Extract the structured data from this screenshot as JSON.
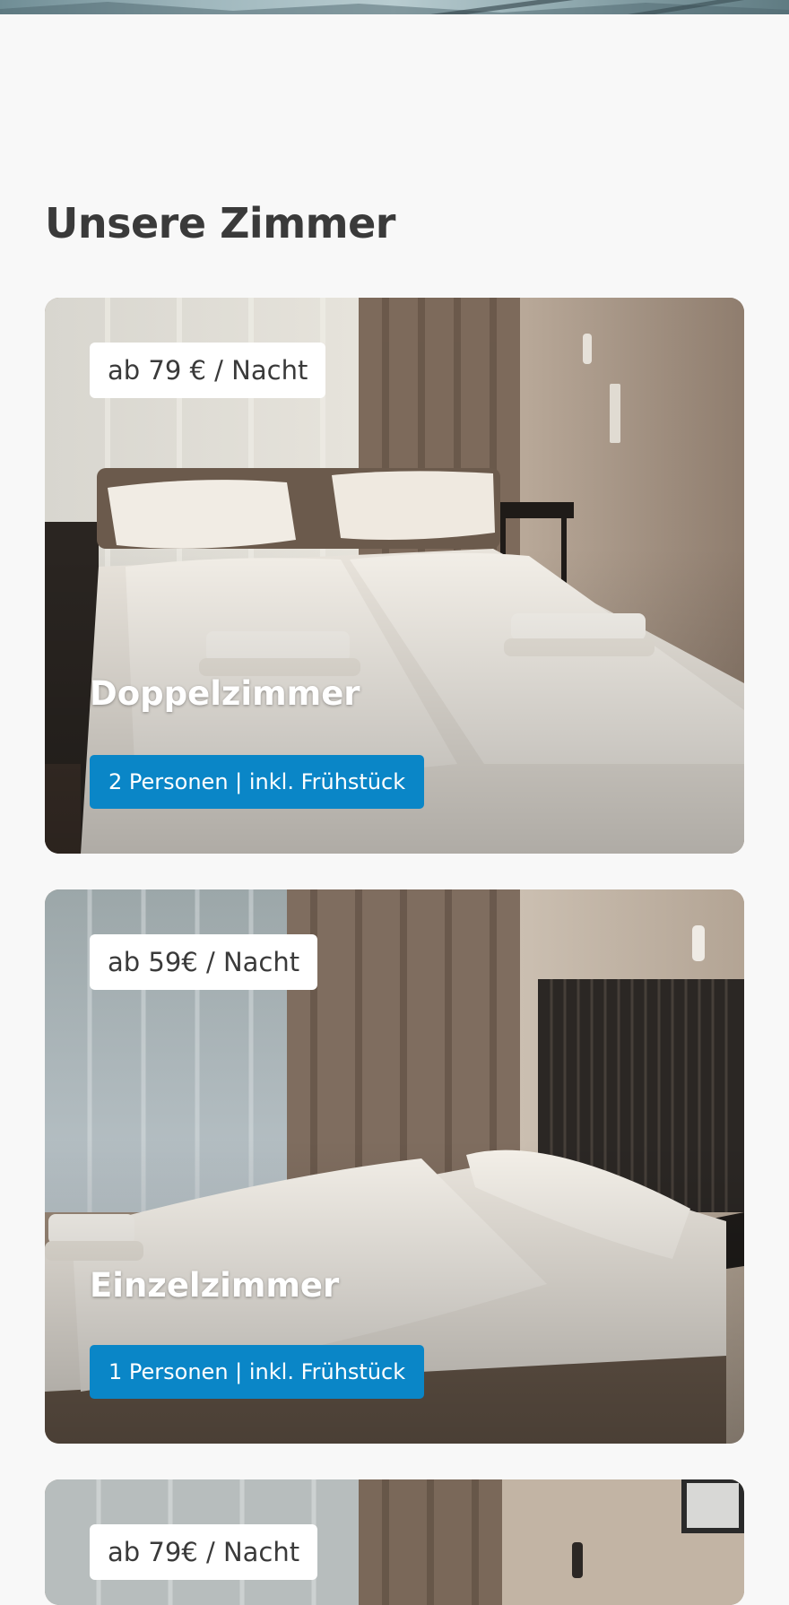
{
  "section": {
    "title": "Unsere Zimmer"
  },
  "rooms": [
    {
      "price": "ab 79 € / Nacht",
      "name": "Doppelzimmer",
      "details": "2 Personen | inkl. Frühstück"
    },
    {
      "price": "ab 59€ / Nacht",
      "name": "Einzelzimmer",
      "details": "1 Personen | inkl. Frühstück"
    },
    {
      "price": "ab 79€ / Nacht"
    }
  ],
  "colors": {
    "accent": "#0a86c7",
    "background": "#f8f8f8",
    "title": "#3a3a3a"
  }
}
